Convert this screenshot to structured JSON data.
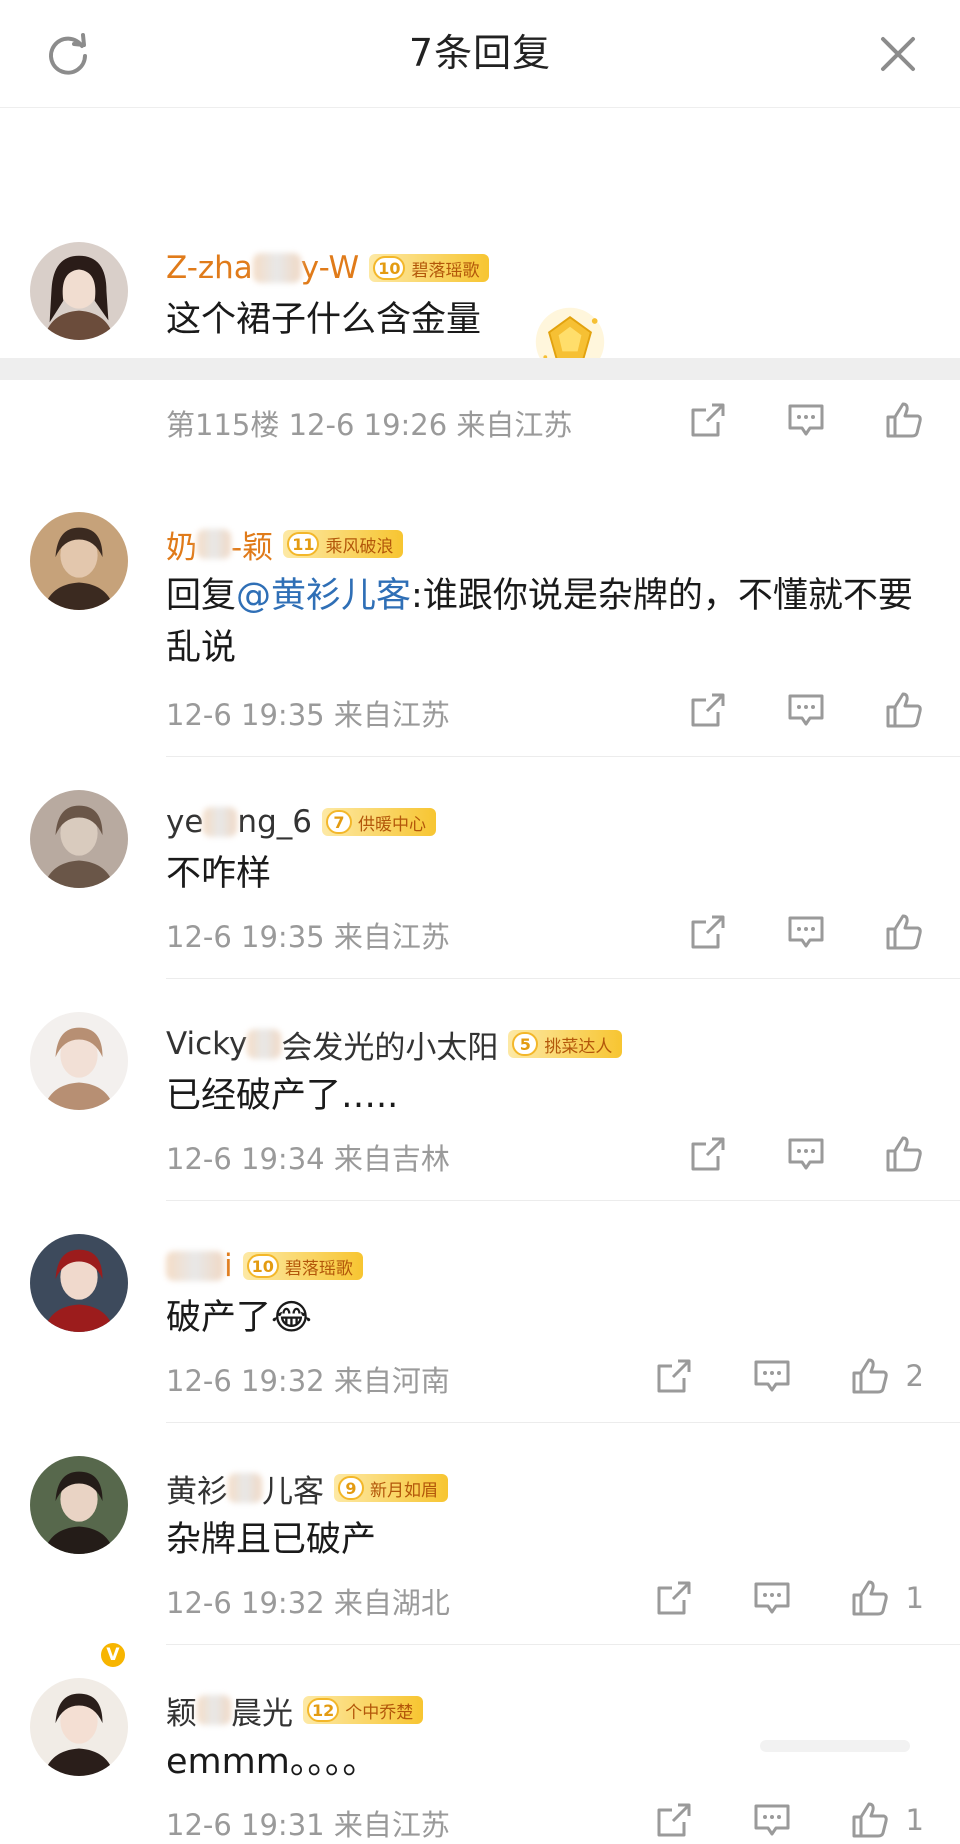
{
  "header": {
    "title": "7条回复"
  },
  "top_comment": {
    "username_prefix": "Z-zha",
    "username_suffix": "y-W",
    "badge_level": "10",
    "badge_text": "碧落瑶歌",
    "text": "这个裙子什么含金量",
    "floor": "第115楼",
    "time": "12-6 19:26",
    "location": "来自江苏"
  },
  "replies": [
    {
      "name_prefix": "奶",
      "name_suffix": "-颖",
      "badge_level": "11",
      "badge_text": "乘风破浪",
      "text_prefix": "回复",
      "mention": "@黄衫儿客",
      "text": ":谁跟你说是杂牌的，不懂就不要乱说",
      "time": "12-6 19:35",
      "location": "来自江苏",
      "likes": ""
    },
    {
      "name_prefix": "ye",
      "name_suffix": "ng_6",
      "badge_level": "7",
      "badge_text": "供暖中心",
      "text": "不咋样",
      "time": "12-6 19:35",
      "location": "来自江苏",
      "likes": ""
    },
    {
      "name_prefix": "Vicky",
      "name_suffix": "会发光的小太阳",
      "badge_level": "5",
      "badge_text": "挑菜达人",
      "text": "已经破产了…..",
      "time": "12-6 19:34",
      "location": "来自吉林",
      "likes": ""
    },
    {
      "name_prefix": "",
      "name_suffix": "i",
      "badge_level": "10",
      "badge_text": "碧落瑶歌",
      "text": "破产了",
      "emoji": "😂",
      "time": "12-6 19:32",
      "location": "来自河南",
      "likes": "2"
    },
    {
      "name_prefix": "黄衫",
      "name_suffix": "儿客",
      "badge_level": "9",
      "badge_text": "新月如眉",
      "text": "杂牌且已破产",
      "time": "12-6 19:32",
      "location": "来自湖北",
      "likes": "1"
    },
    {
      "name_prefix": "颖",
      "name_suffix": "晨光",
      "badge_level": "12",
      "badge_text": "个中乔楚",
      "text": "emmm。。。。",
      "time": "12-6 19:31",
      "location": "来自江苏",
      "likes": "1"
    }
  ],
  "verify_mark": "V",
  "icons": [
    "refresh-icon",
    "close-icon",
    "share-icon",
    "comment-icon",
    "like-icon",
    "trophy-icon"
  ]
}
